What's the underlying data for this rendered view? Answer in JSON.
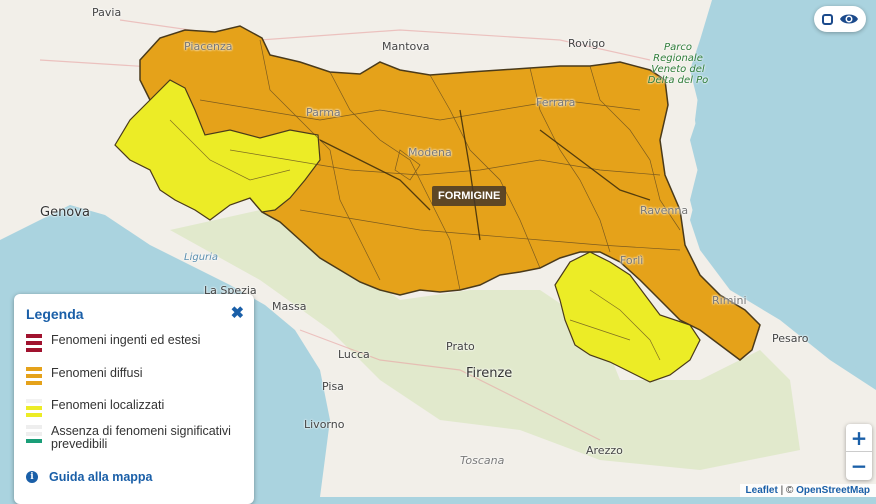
{
  "map": {
    "region_label": "FORMIGINE",
    "colors": {
      "sea": "#aad3df",
      "land": "#f2efe9",
      "hills": "#dfe8c9",
      "orange": "#e5a21a",
      "yellow": "#ecec26",
      "border": "#4a3a1a"
    },
    "places": [
      {
        "name": "Pavia"
      },
      {
        "name": "Mantova"
      },
      {
        "name": "Rovigo"
      },
      {
        "name": "Genova"
      },
      {
        "name": "Ferrara"
      },
      {
        "name": "Parma"
      },
      {
        "name": "Modena"
      },
      {
        "name": "Ravenna"
      },
      {
        "name": "Forlì"
      },
      {
        "name": "Rimini"
      },
      {
        "name": "Pesaro"
      },
      {
        "name": "La Spezia"
      },
      {
        "name": "Massa"
      },
      {
        "name": "Lucca"
      },
      {
        "name": "Prato"
      },
      {
        "name": "Firenze"
      },
      {
        "name": "Pisa"
      },
      {
        "name": "Livorno"
      },
      {
        "name": "Arezzo"
      },
      {
        "name": "Toscana"
      },
      {
        "name": "Liguria"
      },
      {
        "name": "Piacenza"
      }
    ],
    "park_label": "Parco Regionale Veneto del Delta del Po"
  },
  "legend": {
    "title": "Legenda",
    "close_icon": "close-icon",
    "items": [
      {
        "label": "Fenomeni ingenti ed estesi",
        "color": "#a0122e"
      },
      {
        "label": "Fenomeni diffusi",
        "color": "#e5a21a"
      },
      {
        "label": "Fenomeni localizzati",
        "color": "#ecec26"
      },
      {
        "label": "Assenza di fenomeni significativi prevedibili",
        "color": "#1a9e78"
      }
    ],
    "guide_label": "Guida alla mappa"
  },
  "controls": {
    "zoom_in": "+",
    "zoom_out": "−"
  },
  "attribution": {
    "leaflet": "Leaflet",
    "separator": "| ©",
    "osm": "OpenStreetMap"
  }
}
